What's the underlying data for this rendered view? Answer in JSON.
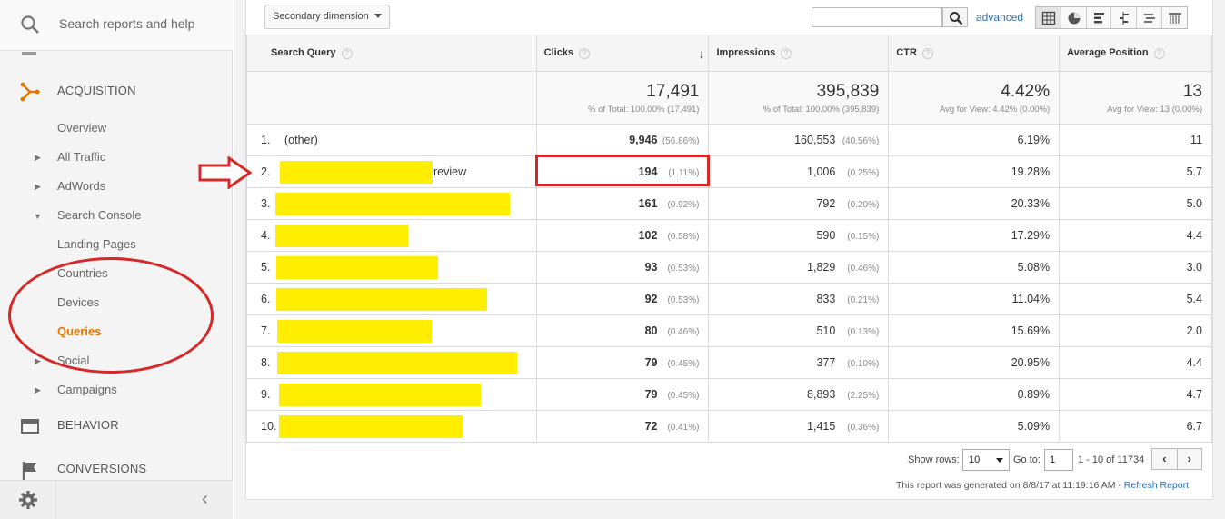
{
  "sidebar": {
    "search_placeholder": "Search reports and help",
    "acquisition_label": "ACQUISITION",
    "overview": "Overview",
    "all_traffic": "All Traffic",
    "adwords": "AdWords",
    "search_console": "Search Console",
    "landing_pages": "Landing Pages",
    "countries": "Countries",
    "devices": "Devices",
    "queries": "Queries",
    "social": "Social",
    "campaigns": "Campaigns",
    "behavior_label": "BEHAVIOR",
    "conversions_label": "CONVERSIONS",
    "collapse_glyph": "‹",
    "accent_color": "#e37400"
  },
  "toolbar": {
    "secondary_dimension": "Secondary dimension",
    "advanced": "advanced"
  },
  "table": {
    "headers": {
      "query": "Search Query",
      "clicks": "Clicks",
      "impressions": "Impressions",
      "ctr": "CTR",
      "position": "Average Position",
      "help_glyph": "?",
      "sort_glyph": "↓"
    },
    "totals": {
      "clicks": "17,491",
      "clicks_sub": "% of Total: 100.00% (17,491)",
      "impressions": "395,839",
      "impressions_sub": "% of Total: 100.00% (395,839)",
      "ctr": "4.42%",
      "ctr_sub": "Avg for View: 4.42% (0.00%)",
      "position": "13",
      "position_sub": "Avg for View: 13 (0.00%)"
    },
    "rows": [
      {
        "n": "1.",
        "q": "(other)",
        "clicks": "9,946",
        "cp": "(56.86%)",
        "imp": "160,553",
        "ip": "(40.56%)",
        "ctr": "6.19%",
        "pos": "11"
      },
      {
        "n": "2.",
        "q": "review",
        "clicks": "194",
        "cp": "(1.11%)",
        "imp": "1,006",
        "ip": "(0.25%)",
        "ctr": "19.28%",
        "pos": "5.7"
      },
      {
        "n": "3.",
        "q": "",
        "clicks": "161",
        "cp": "(0.92%)",
        "imp": "792",
        "ip": "(0.20%)",
        "ctr": "20.33%",
        "pos": "5.0"
      },
      {
        "n": "4.",
        "q": "",
        "clicks": "102",
        "cp": "(0.58%)",
        "imp": "590",
        "ip": "(0.15%)",
        "ctr": "17.29%",
        "pos": "4.4"
      },
      {
        "n": "5.",
        "q": "",
        "clicks": "93",
        "cp": "(0.53%)",
        "imp": "1,829",
        "ip": "(0.46%)",
        "ctr": "5.08%",
        "pos": "3.0"
      },
      {
        "n": "6.",
        "q": "",
        "clicks": "92",
        "cp": "(0.53%)",
        "imp": "833",
        "ip": "(0.21%)",
        "ctr": "11.04%",
        "pos": "5.4"
      },
      {
        "n": "7.",
        "q": "",
        "clicks": "80",
        "cp": "(0.46%)",
        "imp": "510",
        "ip": "(0.13%)",
        "ctr": "15.69%",
        "pos": "2.0"
      },
      {
        "n": "8.",
        "q": "",
        "clicks": "79",
        "cp": "(0.45%)",
        "imp": "377",
        "ip": "(0.10%)",
        "ctr": "20.95%",
        "pos": "4.4"
      },
      {
        "n": "9.",
        "q": "",
        "clicks": "79",
        "cp": "(0.45%)",
        "imp": "8,893",
        "ip": "(2.25%)",
        "ctr": "0.89%",
        "pos": "4.7"
      },
      {
        "n": "10.",
        "q": "",
        "clicks": "72",
        "cp": "(0.41%)",
        "imp": "1,415",
        "ip": "(0.36%)",
        "ctr": "5.09%",
        "pos": "6.7"
      }
    ]
  },
  "pagination": {
    "show_rows_label": "Show rows:",
    "show_rows_value": "10",
    "goto_label": "Go to:",
    "goto_value": "1",
    "range": "1 - 10 of 11734",
    "prev_glyph": "‹",
    "next_glyph": "›",
    "generated": "This report was generated on 8/8/17 at 11:19:16 AM - ",
    "refresh": "Refresh Report"
  }
}
